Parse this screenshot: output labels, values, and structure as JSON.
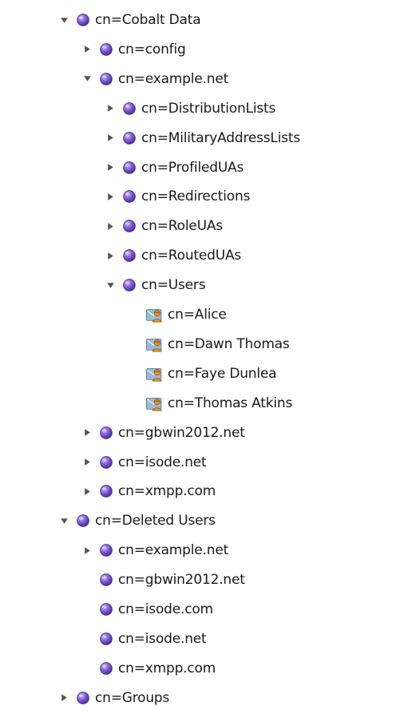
{
  "tree": {
    "items": [
      {
        "label": "cn=Cobalt Data",
        "level": 0,
        "expander": "expanded",
        "icon": "ldap-entry-icon"
      },
      {
        "label": "cn=config",
        "level": 1,
        "expander": "collapsed",
        "icon": "ldap-entry-icon"
      },
      {
        "label": "cn=example.net",
        "level": 1,
        "expander": "expanded",
        "icon": "ldap-entry-icon"
      },
      {
        "label": "cn=DistributionLists",
        "level": 2,
        "expander": "collapsed",
        "icon": "ldap-entry-icon"
      },
      {
        "label": "cn=MilitaryAddressLists",
        "level": 2,
        "expander": "collapsed",
        "icon": "ldap-entry-icon"
      },
      {
        "label": "cn=ProfiledUAs",
        "level": 2,
        "expander": "collapsed",
        "icon": "ldap-entry-icon"
      },
      {
        "label": "cn=Redirections",
        "level": 2,
        "expander": "collapsed",
        "icon": "ldap-entry-icon"
      },
      {
        "label": "cn=RoleUAs",
        "level": 2,
        "expander": "collapsed",
        "icon": "ldap-entry-icon"
      },
      {
        "label": "cn=RoutedUAs",
        "level": 2,
        "expander": "collapsed",
        "icon": "ldap-entry-icon"
      },
      {
        "label": "cn=Users",
        "level": 2,
        "expander": "expanded",
        "icon": "ldap-entry-icon"
      },
      {
        "label": "cn=Alice",
        "level": 3,
        "expander": "none",
        "icon": "user-entry-icon"
      },
      {
        "label": "cn=Dawn Thomas",
        "level": 3,
        "expander": "none",
        "icon": "user-entry-icon"
      },
      {
        "label": "cn=Faye Dunlea",
        "level": 3,
        "expander": "none",
        "icon": "user-entry-icon"
      },
      {
        "label": "cn=Thomas Atkins",
        "level": 3,
        "expander": "none",
        "icon": "user-entry-icon"
      },
      {
        "label": "cn=gbwin2012.net",
        "level": 1,
        "expander": "collapsed",
        "icon": "ldap-entry-icon"
      },
      {
        "label": "cn=isode.net",
        "level": 1,
        "expander": "collapsed",
        "icon": "ldap-entry-icon"
      },
      {
        "label": "cn=xmpp.com",
        "level": 1,
        "expander": "collapsed",
        "icon": "ldap-entry-icon"
      },
      {
        "label": "cn=Deleted Users",
        "level": 0,
        "expander": "expanded",
        "icon": "ldap-entry-icon"
      },
      {
        "label": "cn=example.net",
        "level": 1,
        "expander": "collapsed",
        "icon": "ldap-entry-icon"
      },
      {
        "label": "cn=gbwin2012.net",
        "level": 1,
        "expander": "none",
        "icon": "ldap-entry-icon"
      },
      {
        "label": "cn=isode.com",
        "level": 1,
        "expander": "none",
        "icon": "ldap-entry-icon"
      },
      {
        "label": "cn=isode.net",
        "level": 1,
        "expander": "none",
        "icon": "ldap-entry-icon"
      },
      {
        "label": "cn=xmpp.com",
        "level": 1,
        "expander": "none",
        "icon": "ldap-entry-icon"
      },
      {
        "label": "cn=Groups",
        "level": 0,
        "expander": "collapsed",
        "icon": "ldap-entry-icon"
      }
    ]
  },
  "colors": {
    "entry_icon": "#7b5ccf",
    "user_icon_card": "#9bbcd6",
    "user_icon_person": "#e39a2d",
    "expander": "#555555"
  }
}
